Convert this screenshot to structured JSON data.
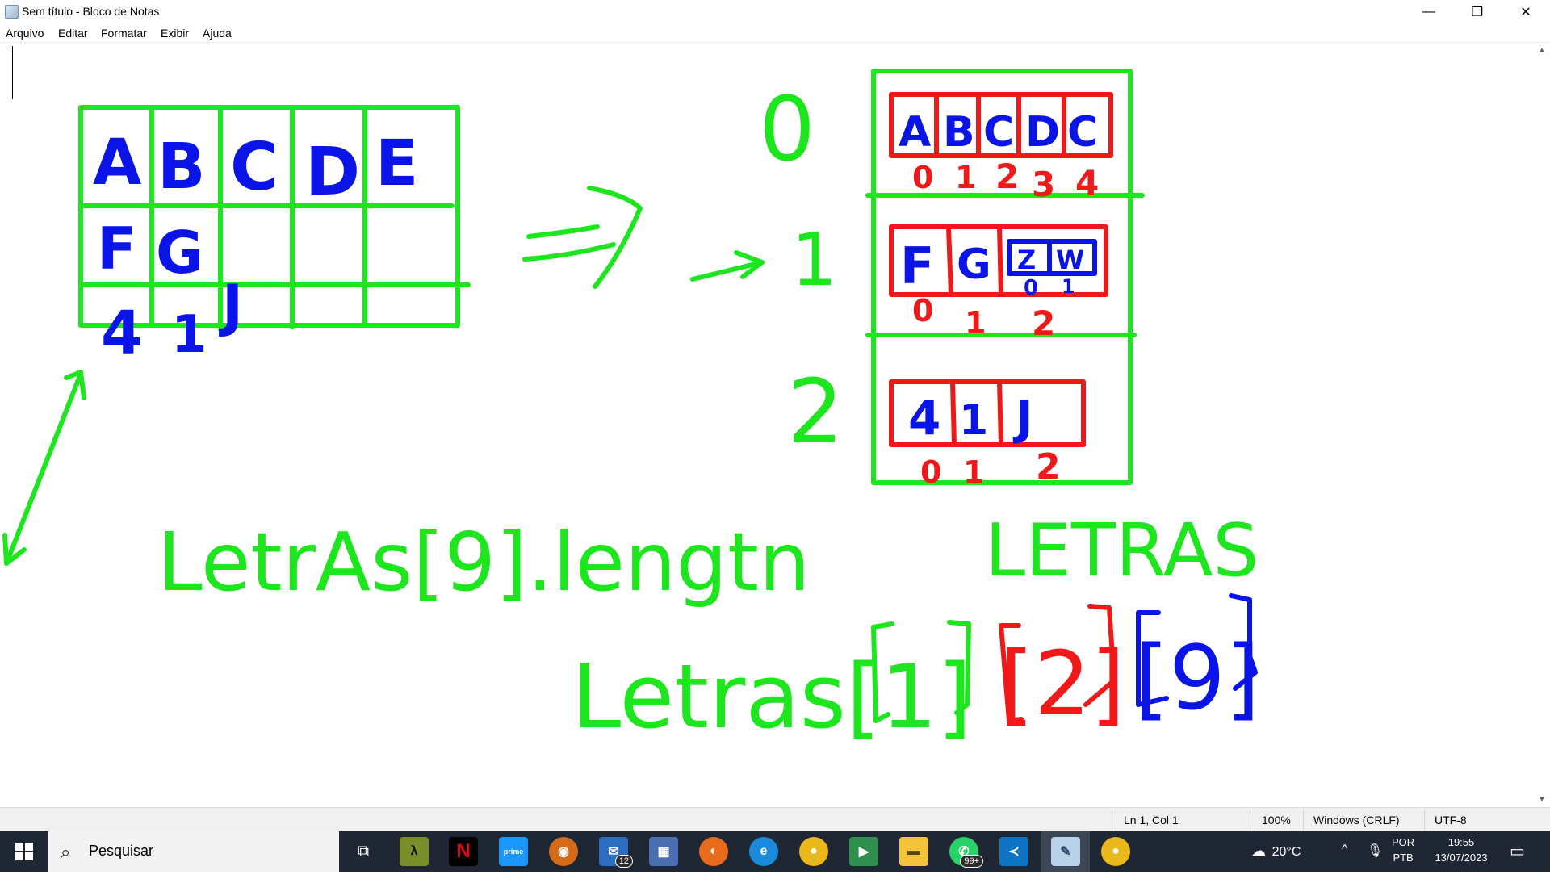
{
  "window": {
    "title": "Sem título - Bloco de Notas",
    "controls": {
      "minimize": "—",
      "maximize": "❐",
      "close": "✕"
    }
  },
  "menu": [
    "Arquivo",
    "Editar",
    "Formatar",
    "Exibir",
    "Ajuda"
  ],
  "statusbar": {
    "position": "Ln 1, Col 1",
    "zoom": "100%",
    "line_ending": "Windows (CRLF)",
    "encoding": "UTF-8"
  },
  "drawing": {
    "grid_letters": [
      "A",
      "B",
      "C",
      "D",
      "E",
      "F",
      "G",
      "4",
      "1",
      "J"
    ],
    "row_indices": [
      "0",
      "1",
      "2"
    ],
    "box0_letters": [
      "A",
      "B",
      "C",
      "D",
      "C"
    ],
    "box0_indices": [
      "0",
      "1",
      "2",
      "3",
      "4"
    ],
    "box1_letters": [
      "F",
      "G",
      "Z",
      "W"
    ],
    "box1_indices": [
      "0",
      "1",
      "2"
    ],
    "box1_inner_indices": [
      "0",
      "1"
    ],
    "box2_letters": [
      "4",
      "1",
      "J"
    ],
    "box2_indices": [
      "0",
      "1",
      "2"
    ],
    "text_lengtn": "LetrAs[9].lengtn",
    "text_letras": "LETRAS",
    "text_letras_idx_green": "Letras[1]",
    "text_letras_idx_red": "[2]",
    "text_letras_idx_blue": "[9]"
  },
  "taskbar": {
    "search_placeholder": "Pesquisar",
    "mail_badge": "12",
    "whatsapp_badge": "99+",
    "weather": "20°C",
    "language": "POR",
    "keyboard": "PTB",
    "time": "19:55",
    "date": "13/07/2023"
  },
  "colors": {
    "green": "#1ee61e",
    "red": "#f01919",
    "blue": "#0a14e6",
    "taskbar": "#1f2734"
  }
}
